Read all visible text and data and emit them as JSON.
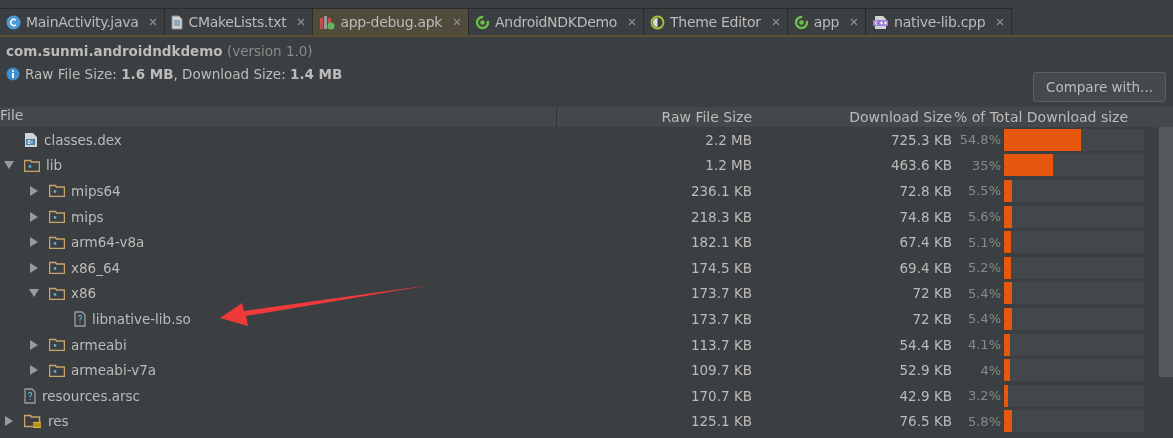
{
  "tabs": [
    {
      "label": "MainActivity.java",
      "kind": "class",
      "selected": false
    },
    {
      "label": "CMakeLists.txt",
      "kind": "text",
      "selected": false
    },
    {
      "label": "app-debug.apk",
      "kind": "apk",
      "selected": true
    },
    {
      "label": "AndroidNDKDemo",
      "kind": "module",
      "selected": false
    },
    {
      "label": "Theme Editor",
      "kind": "theme",
      "selected": false
    },
    {
      "label": "app",
      "kind": "module",
      "selected": false
    },
    {
      "label": "native-lib.cpp",
      "kind": "cpp",
      "selected": false
    }
  ],
  "package": {
    "name": "com.sunmi.androidndkdemo",
    "version": "(version 1.0)"
  },
  "summary": "Raw File Size: **1.6 MB**, Download Size: **1.4 MB**",
  "compare_button": "Compare with...",
  "table": {
    "columns": [
      "File",
      "Raw File Size",
      "Download Size",
      "% of Total Download size"
    ],
    "rows": [
      {
        "name": "classes.dex",
        "kind": "dex",
        "raw": "2.2 MB",
        "download": "725.3 KB",
        "percent": "54.8%",
        "level": 0.548
      },
      {
        "name": "lib",
        "kind": "folder",
        "expanded": true,
        "raw": "1.2 MB",
        "download": "463.6 KB",
        "percent": "35%",
        "level": 0.35,
        "children": [
          {
            "name": "mips64",
            "kind": "folder",
            "expanded": false,
            "raw": "236.1 KB",
            "download": "72.8 KB",
            "percent": "5.5%",
            "level": 0.055
          },
          {
            "name": "mips",
            "kind": "folder",
            "expanded": false,
            "raw": "218.3 KB",
            "download": "74.8 KB",
            "percent": "5.6%",
            "level": 0.056
          },
          {
            "name": "arm64-v8a",
            "kind": "folder",
            "expanded": false,
            "raw": "182.1 KB",
            "download": "67.4 KB",
            "percent": "5.1%",
            "level": 0.051
          },
          {
            "name": "x86_64",
            "kind": "folder",
            "expanded": false,
            "raw": "174.5 KB",
            "download": "69.4 KB",
            "percent": "5.2%",
            "level": 0.052
          },
          {
            "name": "x86",
            "kind": "folder",
            "expanded": true,
            "raw": "173.7 KB",
            "download": "72 KB",
            "percent": "5.4%",
            "level": 0.054,
            "children": [
              {
                "name": "libnative-lib.so",
                "kind": "unknown",
                "raw": "173.7 KB",
                "download": "72 KB",
                "percent": "5.4%",
                "level": 0.054
              }
            ]
          },
          {
            "name": "armeabi",
            "kind": "folder",
            "expanded": false,
            "raw": "113.7 KB",
            "download": "54.4 KB",
            "percent": "4.1%",
            "level": 0.041
          },
          {
            "name": "armeabi-v7a",
            "kind": "folder",
            "expanded": false,
            "raw": "109.7 KB",
            "download": "52.9 KB",
            "percent": "4%",
            "level": 0.04
          }
        ]
      },
      {
        "name": "resources.arsc",
        "kind": "unknown",
        "raw": "170.7 KB",
        "download": "42.9 KB",
        "percent": "3.2%",
        "level": 0.032
      },
      {
        "name": "res",
        "kind": "res-folder",
        "expanded": false,
        "raw": "125.1 KB",
        "download": "76.5 KB",
        "percent": "5.8%",
        "level": 0.058
      }
    ]
  }
}
